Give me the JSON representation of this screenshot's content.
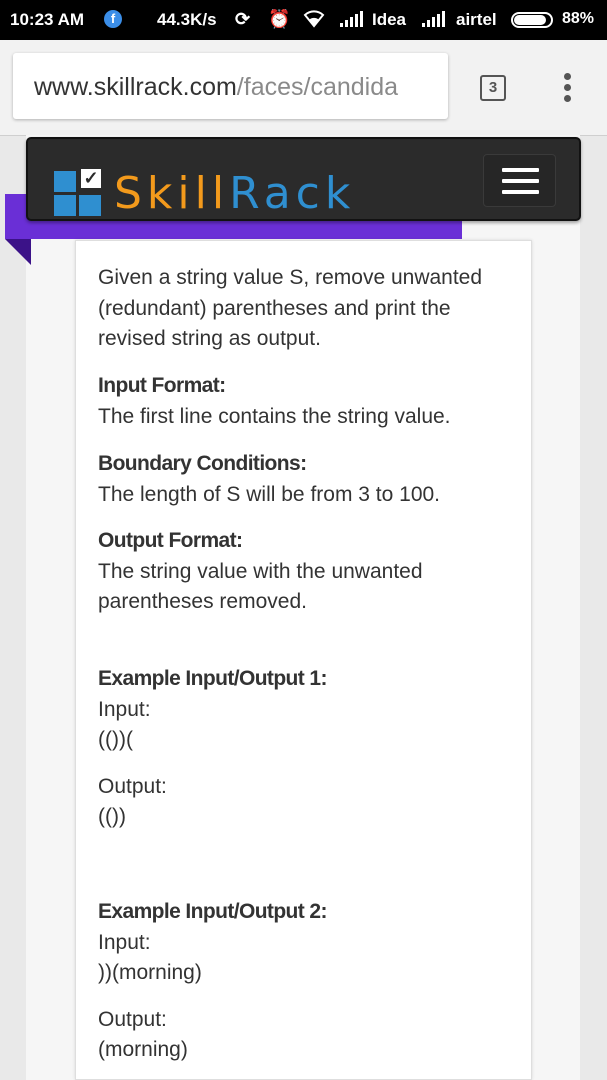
{
  "status_bar": {
    "time": "10:23 AM",
    "notification": "f",
    "speed": "44.3K/s",
    "carrier1": "Idea",
    "carrier2": "airtel",
    "battery": "88%",
    "battery_level": 0.88
  },
  "browser": {
    "url_host": "www.skillrack.com",
    "url_path": "/faces/candida",
    "tab_count": "3"
  },
  "header": {
    "logo_part1": "Skill",
    "logo_part2": "Rack"
  },
  "problem": {
    "description_lines": [
      "Given a string value S, remove unwanted",
      "(redundant) parentheses and print the",
      "revised string as output."
    ],
    "input_format_heading": "Input Format:",
    "input_format_text": "The first line contains the string value.",
    "boundary_heading": "Boundary Conditions:",
    "boundary_text": "The length of S will be from 3 to 100.",
    "output_format_heading": "Output Format:",
    "output_format_lines": [
      "The string value with the unwanted",
      "parentheses removed."
    ],
    "examples": [
      {
        "heading": "Example Input/Output 1:",
        "input_label": "Input:",
        "input_value": "(())(",
        "output_label": "Output:",
        "output_value": "(())"
      },
      {
        "heading": "Example Input/Output 2:",
        "input_label": "Input:",
        "input_value": "))(morning)",
        "output_label": "Output:",
        "output_value": "(morning)"
      }
    ]
  }
}
